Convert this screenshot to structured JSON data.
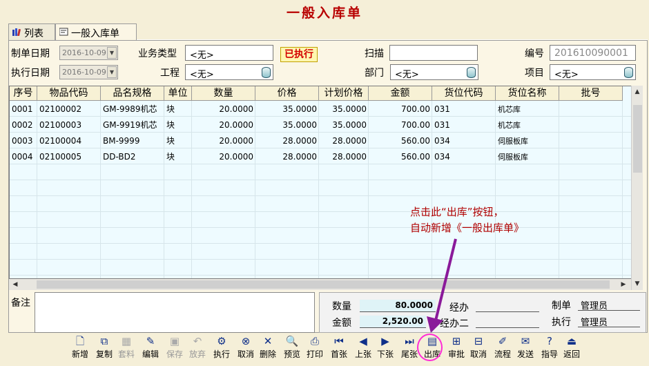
{
  "window": {
    "title": "一般入库单"
  },
  "tabs": [
    {
      "label": "列表",
      "icon": "books-icon"
    },
    {
      "label": "一般入库单",
      "icon": "form-icon"
    }
  ],
  "form": {
    "make_date_label": "制单日期",
    "make_date": "2016-10-09",
    "exec_date_label": "执行日期",
    "exec_date": "2016-10-09",
    "biz_type_label": "业务类型",
    "biz_type": "<无>",
    "project_label": "工程",
    "project": "<无>",
    "status": "已执行",
    "scan_label": "扫描",
    "scan": "",
    "dept_label": "部门",
    "dept": "<无>",
    "number_label": "编号",
    "number": "201610090001",
    "item_label": "项目",
    "item": "<无>"
  },
  "table": {
    "columns": [
      "序号",
      "物品代码",
      "品名规格",
      "单位",
      "数量",
      "价格",
      "计划价格",
      "金额",
      "货位代码",
      "货位名称",
      "批号"
    ],
    "rows": [
      [
        "0001",
        "02100002",
        "GM-9989机芯",
        "块",
        "20.0000",
        "35.0000",
        "35.0000",
        "700.00",
        "031",
        "机芯库",
        ""
      ],
      [
        "0002",
        "02100003",
        "GM-9919机芯",
        "块",
        "20.0000",
        "35.0000",
        "35.0000",
        "700.00",
        "031",
        "机芯库",
        ""
      ],
      [
        "0003",
        "02100004",
        "BM-9999",
        "块",
        "20.0000",
        "28.0000",
        "28.0000",
        "560.00",
        "034",
        "伺服板库",
        ""
      ],
      [
        "0004",
        "02100005",
        "DD-BD2",
        "块",
        "20.0000",
        "28.0000",
        "28.0000",
        "560.00",
        "034",
        "伺服板库",
        ""
      ]
    ]
  },
  "footer": {
    "remark_label": "备注",
    "remark": "",
    "qty_label": "数量",
    "qty": "80.0000",
    "amount_label": "金额",
    "amount": "2,520.00",
    "handler_label": "经办",
    "handler": "",
    "handler2_label": "经办二",
    "handler2": "",
    "maker_label": "制单",
    "maker": "管理员",
    "executor_label": "执行",
    "executor": "管理员"
  },
  "toolbar": [
    {
      "label": "新增",
      "icon": "new-doc-icon",
      "enabled": true
    },
    {
      "label": "复制",
      "icon": "copy-icon",
      "enabled": true
    },
    {
      "label": "套料",
      "icon": "calculator-icon",
      "enabled": false
    },
    {
      "label": "编辑",
      "icon": "edit-icon",
      "enabled": true
    },
    {
      "label": "保存",
      "icon": "save-icon",
      "enabled": false
    },
    {
      "label": "放弃",
      "icon": "undo-icon",
      "enabled": false
    },
    {
      "label": "执行",
      "icon": "execute-icon",
      "enabled": true
    },
    {
      "label": "取消",
      "icon": "cancel-exec-icon",
      "enabled": true
    },
    {
      "label": "删除",
      "icon": "delete-icon",
      "enabled": true
    },
    {
      "label": "预览",
      "icon": "preview-icon",
      "enabled": true
    },
    {
      "label": "打印",
      "icon": "print-icon",
      "enabled": true
    },
    {
      "label": "首张",
      "icon": "first-icon",
      "enabled": true
    },
    {
      "label": "上张",
      "icon": "prev-icon",
      "enabled": true
    },
    {
      "label": "下张",
      "icon": "next-icon",
      "enabled": true
    },
    {
      "label": "尾张",
      "icon": "last-icon",
      "enabled": true
    },
    {
      "label": "出库",
      "icon": "outbound-icon",
      "enabled": true
    },
    {
      "label": "审批",
      "icon": "approve-icon",
      "enabled": true
    },
    {
      "label": "取消",
      "icon": "cancel-approve-icon",
      "enabled": true
    },
    {
      "label": "流程",
      "icon": "flow-icon",
      "enabled": true
    },
    {
      "label": "发送",
      "icon": "send-icon",
      "enabled": true
    },
    {
      "label": "指导",
      "icon": "help-icon",
      "enabled": true
    },
    {
      "label": "返回",
      "icon": "exit-icon",
      "enabled": true
    }
  ],
  "annotation": {
    "line1": "点击此“出库”按钮，",
    "line2": "自动新增《一般出库单》"
  },
  "colors": {
    "title": "#b80000",
    "highlight": "#ff2bd6",
    "arrow": "#8a1a9a",
    "grid_bg": "#eefbff"
  }
}
